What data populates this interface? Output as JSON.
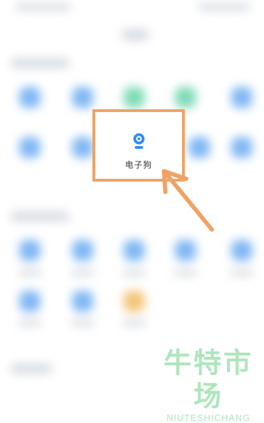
{
  "highlighted_app": {
    "label": "电子狗",
    "icon": "dashcam-camera-icon",
    "icon_color": "#2f8ff0"
  },
  "annotation": {
    "box_color": "#f0a264",
    "arrow_color": "#f0a264"
  },
  "watermark": {
    "chinese": "牛特市场",
    "pinyin": "NIUTESHICHANG",
    "color": "#a8e4b7"
  }
}
